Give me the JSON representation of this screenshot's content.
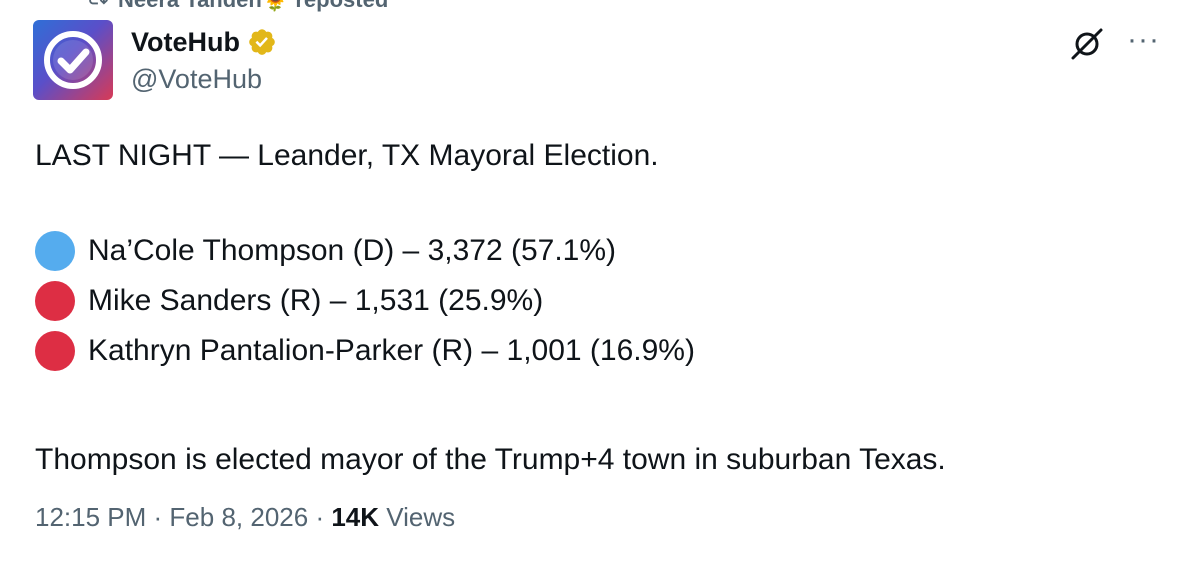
{
  "repost": {
    "label": "Neera Tanden🌻 reposted",
    "icon": "repost-icon"
  },
  "author": {
    "display_name": "VoteHub",
    "handle": "@VoteHub",
    "verified": true,
    "verified_color": "#e2b719",
    "avatar_icon": "checkmark-logo"
  },
  "actions": {
    "grok_icon": "grok-icon",
    "more_label": "···"
  },
  "tweet": {
    "headline": "LAST NIGHT — Leander, TX Mayoral Election.",
    "candidates": [
      {
        "text": "Na’Cole Thompson (D) – 3,372 (57.1%)",
        "color": "#55acee"
      },
      {
        "text": "Mike Sanders (R) – 1,531 (25.9%)",
        "color": "#dd2e44"
      },
      {
        "text": "Kathryn Pantalion-Parker (R) – 1,001 (16.9%)",
        "color": "#dd2e44"
      }
    ],
    "conclusion": "Thompson is elected mayor of the Trump+4 town in suburban Texas."
  },
  "meta": {
    "time": "12:15 PM",
    "date": "Feb 8, 2026",
    "views_count": "14K",
    "views_label": "Views"
  }
}
